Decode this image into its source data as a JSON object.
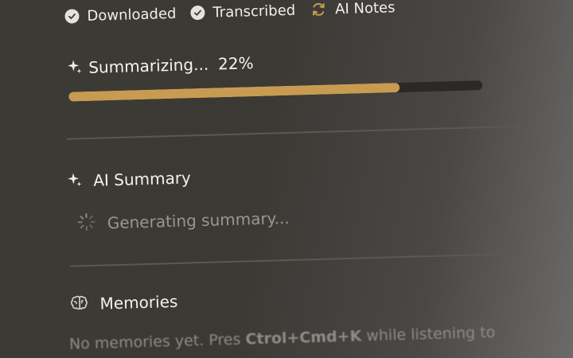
{
  "steps": [
    {
      "label": "Downloaded",
      "state": "done",
      "icon": "check-icon"
    },
    {
      "label": "Transcribed",
      "state": "done",
      "icon": "check-icon"
    },
    {
      "label": "AI Notes",
      "state": "in-progress",
      "icon": "refresh-icon"
    }
  ],
  "progress": {
    "label": "Summarizing...",
    "percent_text": "22%",
    "bar_fill_fraction": 0.8,
    "icon": "sparkle-icon"
  },
  "ai_summary": {
    "title": "AI Summary",
    "icon": "sparkle-icon",
    "status_text": "Generating summary...",
    "status_icon": "loading-spinner-icon"
  },
  "memories": {
    "title": "Memories",
    "icon": "brain-icon",
    "empty_prefix": "No memories yet. Pres",
    "shortcut": "Ctrol+Cmd+K",
    "empty_suffix": "while listening to"
  },
  "colors": {
    "accent": "#c89b52",
    "track": "#2a2925",
    "background": "#3d3a34"
  }
}
